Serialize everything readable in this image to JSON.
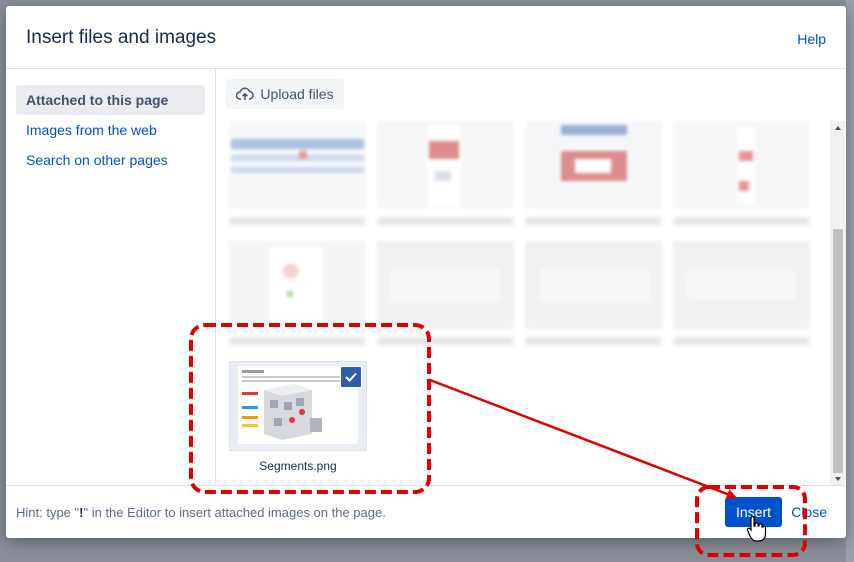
{
  "dialog": {
    "title": "Insert files and images",
    "help_label": "Help"
  },
  "sidebar": {
    "items": [
      {
        "label": "Attached to this page",
        "active": true
      },
      {
        "label": "Images from the web",
        "active": false
      },
      {
        "label": "Search on other pages",
        "active": false
      }
    ]
  },
  "toolbar": {
    "upload_label": "Upload files",
    "upload_icon": "cloud-upload-icon"
  },
  "selected_file": {
    "name": "Segments.png",
    "selected": true
  },
  "footer": {
    "hint_before": "Hint: type \"",
    "hint_key": "!",
    "hint_after": "\" in the Editor to insert attached images on the page.",
    "insert_label": "Insert",
    "close_label": "Close"
  },
  "colors": {
    "accent": "#0052cc",
    "annotation": "#e00000",
    "selection": "#2f5ea8"
  }
}
